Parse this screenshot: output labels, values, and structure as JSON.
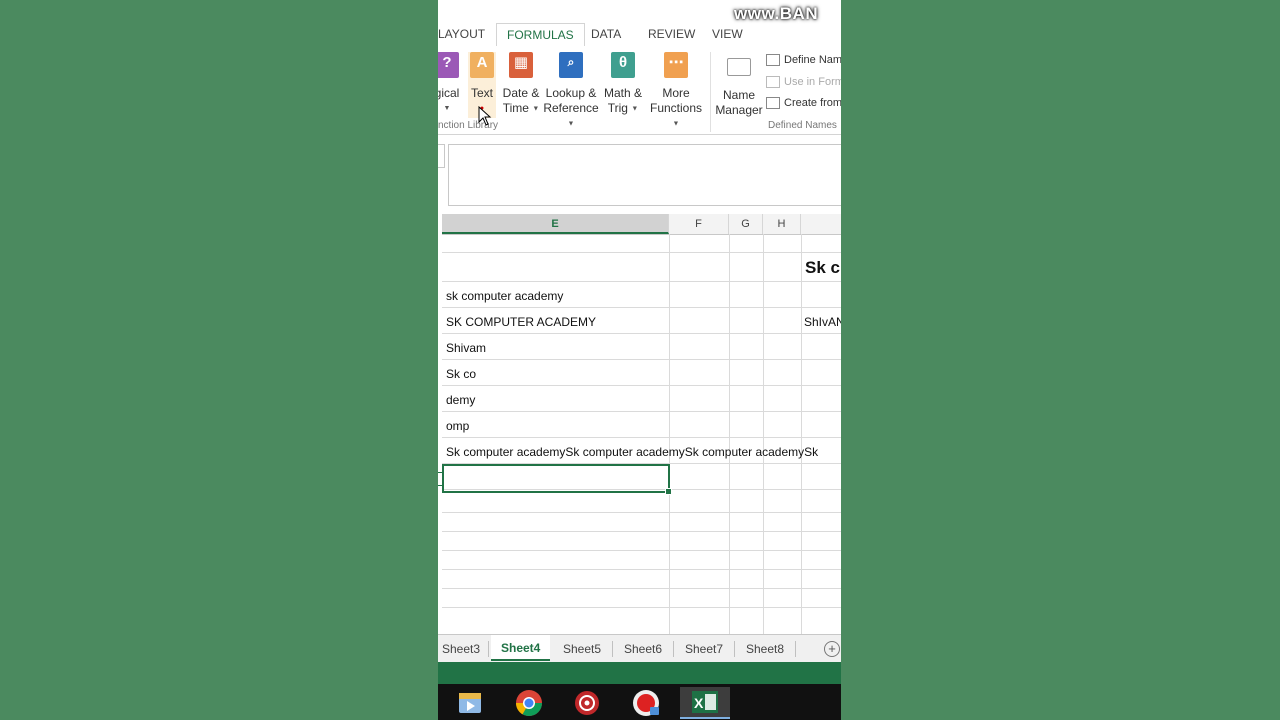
{
  "watermark": "www.BAN",
  "ribbon_tabs": [
    {
      "label": "LAYOUT"
    },
    {
      "label": "FORMULAS",
      "active": true
    },
    {
      "label": "DATA"
    },
    {
      "label": "REVIEW"
    },
    {
      "label": "VIEW"
    }
  ],
  "function_library": {
    "group_label": "nction Library",
    "buttons": [
      {
        "line1": "gical",
        "line2": "",
        "icon": "logical-icon",
        "icon_glyph": "?",
        "color": "#9b59b6"
      },
      {
        "line1": "Text",
        "line2": "",
        "icon": "text-icon",
        "icon_glyph": "A",
        "color": "#f0a050"
      },
      {
        "line1": "Date &",
        "line2": "Time",
        "icon": "date-time-icon",
        "icon_glyph": "▦",
        "color": "#d9603b"
      },
      {
        "line1": "Lookup &",
        "line2": "Reference",
        "icon": "lookup-icon",
        "icon_glyph": "🔍",
        "color": "#2f6fbf"
      },
      {
        "line1": "Math &",
        "line2": "Trig",
        "icon": "math-trig-icon",
        "icon_glyph": "θ",
        "color": "#3f9f8f"
      },
      {
        "line1": "More",
        "line2": "Functions",
        "icon": "more-functions-icon",
        "icon_glyph": "⋯",
        "color": "#f0a050"
      }
    ]
  },
  "defined_names": {
    "group_label": "Defined Names",
    "name_manager": {
      "line1": "Name",
      "line2": "Manager"
    },
    "define_name": "Define Nam",
    "use_in_formula": "Use in Form",
    "create_from": "Create from"
  },
  "columns": [
    {
      "label": "E",
      "selected": true
    },
    {
      "label": "F"
    },
    {
      "label": "G"
    },
    {
      "label": "H"
    },
    {
      "label": ""
    }
  ],
  "cells": {
    "r1_e": "",
    "r2_i": "Sk c",
    "r3_e": "sk computer academy",
    "r4_e": "SK COMPUTER ACADEMY",
    "r4_i": "ShIvAN",
    "r5_e": "Shivam",
    "r6_e": "Sk co",
    "r7_e": "demy",
    "r8_e": "omp",
    "r9_e": "Sk computer academySk computer academySk computer academySk"
  },
  "sheet_tabs": [
    {
      "label": "Sheet3"
    },
    {
      "label": "Sheet4",
      "active": true
    },
    {
      "label": "Sheet5"
    },
    {
      "label": "Sheet6"
    },
    {
      "label": "Sheet7"
    },
    {
      "label": "Sheet8"
    }
  ],
  "add_sheet": "+",
  "taskbar": [
    {
      "icon": "media-player-icon"
    },
    {
      "icon": "chrome-icon"
    },
    {
      "icon": "settings-app-icon"
    },
    {
      "icon": "screen-recorder-icon"
    },
    {
      "icon": "excel-icon",
      "active": true
    }
  ],
  "colors": {
    "accent": "#217346",
    "background": "#4b8a5f"
  }
}
